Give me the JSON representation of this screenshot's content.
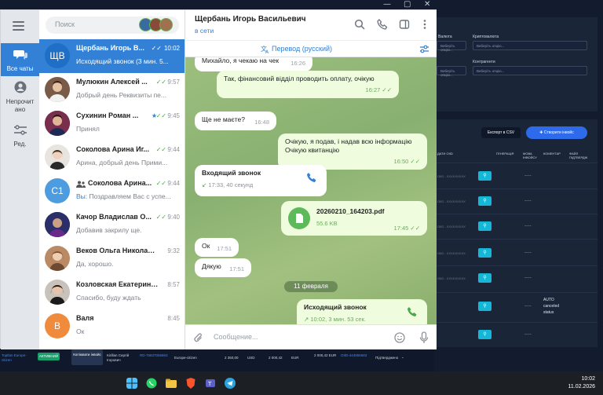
{
  "background": {
    "labels": {
      "crypto": "Криптовалюта",
      "currency": "Валюта",
      "contractors": "Контрагенти"
    },
    "select_placeholder": "Виберіть опцію...",
    "buttons": {
      "export_csv": "Експорт в CSV",
      "create_invoice": "✚ Створити інвойс"
    },
    "table_headers": [
      "ДАТИ OIID",
      "ГЕНЕРАЦІЯ",
      "МОВА ІНВОЙСУ",
      "КОМЕНТАР",
      "ФАЙЛ ПІДТВЕРДЖ"
    ],
    "row_id": "OIID - XXXXXXXXX",
    "dash": "----",
    "auto_text": [
      "AUTO",
      "canceled",
      "status"
    ],
    "bottom_row": {
      "account": "Toptlan Europe-citizen",
      "status": "АКТИВНИЙ",
      "copy_button": "Копіювати інвойс",
      "person": "Kirillan Сергій Ігорович",
      "ref": "RD-76837065863",
      "zone": "Europe-citizen",
      "amount1": "2 350,00",
      "cur1": "USD",
      "amount2": "2 000,42",
      "cur2": "EUR",
      "amount3": "2 000,42 EUR",
      "ref2": "OIID-444856683",
      "state": "Підтверджено"
    }
  },
  "sidebar": {
    "items": [
      {
        "label": "Все чаты",
        "icon": "chats-icon",
        "active": true
      },
      {
        "label": "Непрочит ано",
        "icon": "user-icon",
        "active": false
      },
      {
        "label": "Ред.",
        "icon": "edit-filters-icon",
        "active": false
      }
    ]
  },
  "search": {
    "placeholder": "Поиск"
  },
  "chats": [
    {
      "name": "Щербань Игорь В...",
      "time": "10:02",
      "preview": "Исходящий звонок (3 мин. 5...",
      "initials": "ЩВ",
      "avatar_color": "#3381d6",
      "active": true,
      "status": "read",
      "pinned": false
    },
    {
      "name": "Мулюкин Алексей ...",
      "time": "9:57",
      "preview": "Добрый день Реквизиты пе...",
      "initials": "",
      "avatar_color": "#7a5b4a",
      "active": false,
      "status": "read",
      "pinned": false
    },
    {
      "name": "Сухинин Роман ...",
      "time": "9:45",
      "preview": "Принял",
      "initials": "",
      "avatar_color": "#4a3050",
      "active": false,
      "status": "read",
      "pinned": true
    },
    {
      "name": "Соколова Арина Иг...",
      "time": "9:44",
      "preview": "Арина, добрый день Прими...",
      "initials": "",
      "avatar_color": "#d9d5d0",
      "active": false,
      "status": "read",
      "pinned": false
    },
    {
      "name": "Соколова Арина...",
      "time": "9:44",
      "preview": "Поздравляем Вас с успе...",
      "preview_prefix": "Вы: ",
      "initials": "С1",
      "avatar_color": "#4e9ce0",
      "active": false,
      "status": "read",
      "pinned": false,
      "group": true
    },
    {
      "name": "Качор Владислав О...",
      "time": "9:40",
      "preview": "Добавив закрилу ще.",
      "initials": "",
      "avatar_color": "#3b4a8a",
      "active": false,
      "status": "read",
      "pinned": false
    },
    {
      "name": "Веков Ольга Николаев...",
      "time": "9:32",
      "preview": "Да, хорошо.",
      "initials": "",
      "avatar_color": "#9a6a44",
      "active": false,
      "status": "none",
      "pinned": false
    },
    {
      "name": "Козловская Екатерина ...",
      "time": "8:57",
      "preview": "Спасибо, буду ждать",
      "initials": "",
      "avatar_color": "#5a4a40",
      "active": false,
      "status": "none",
      "pinned": false
    },
    {
      "name": "Валя",
      "time": "8:45",
      "preview": "Ок",
      "initials": "В",
      "avatar_color": "#f08a3c",
      "active": false,
      "status": "none",
      "pinned": false
    }
  ],
  "conversation": {
    "peer_name": "Щербань Игорь Васильевич",
    "peer_status": "в сети",
    "translate_label": "Перевод (русский)",
    "date_separator": "11 февраля",
    "composer_placeholder": "Сообщение...",
    "messages": [
      {
        "dir": "in",
        "text": "Михайло, я чекаю на чек",
        "time": "16:26"
      },
      {
        "dir": "out",
        "text": "Так, фінансовий відділ проводить оплату, очікую",
        "time": "16:27"
      },
      {
        "dir": "in",
        "text": "Ще не маєте?",
        "time": "16:48"
      },
      {
        "dir": "out",
        "text": "Очікую, я подав, і надав всю інформацію Очікую квитанцію",
        "time": "16:50"
      },
      {
        "dir": "in",
        "kind": "call",
        "title": "Входящий звонок",
        "sub": "17:33, 40 секунд"
      },
      {
        "dir": "out",
        "kind": "file",
        "title": "20260210_164203.pdf",
        "sub": "55.6 KB",
        "time": "17:45"
      },
      {
        "dir": "in",
        "text": "Ок",
        "time": "17:51"
      },
      {
        "dir": "in",
        "text": "Дякую",
        "time": "17:51"
      },
      {
        "dir": "out",
        "kind": "call",
        "title": "Исходящий звонок",
        "sub": "10:02, 3 мин. 53 сек."
      }
    ]
  },
  "taskbar": {
    "time": "10:02",
    "date": "11.02.2026"
  },
  "colors": {
    "accent": "#3381d6",
    "chat_bg": "#9dbf7e",
    "bubble_out": "#effdde",
    "check_green": "#4aa84a"
  }
}
